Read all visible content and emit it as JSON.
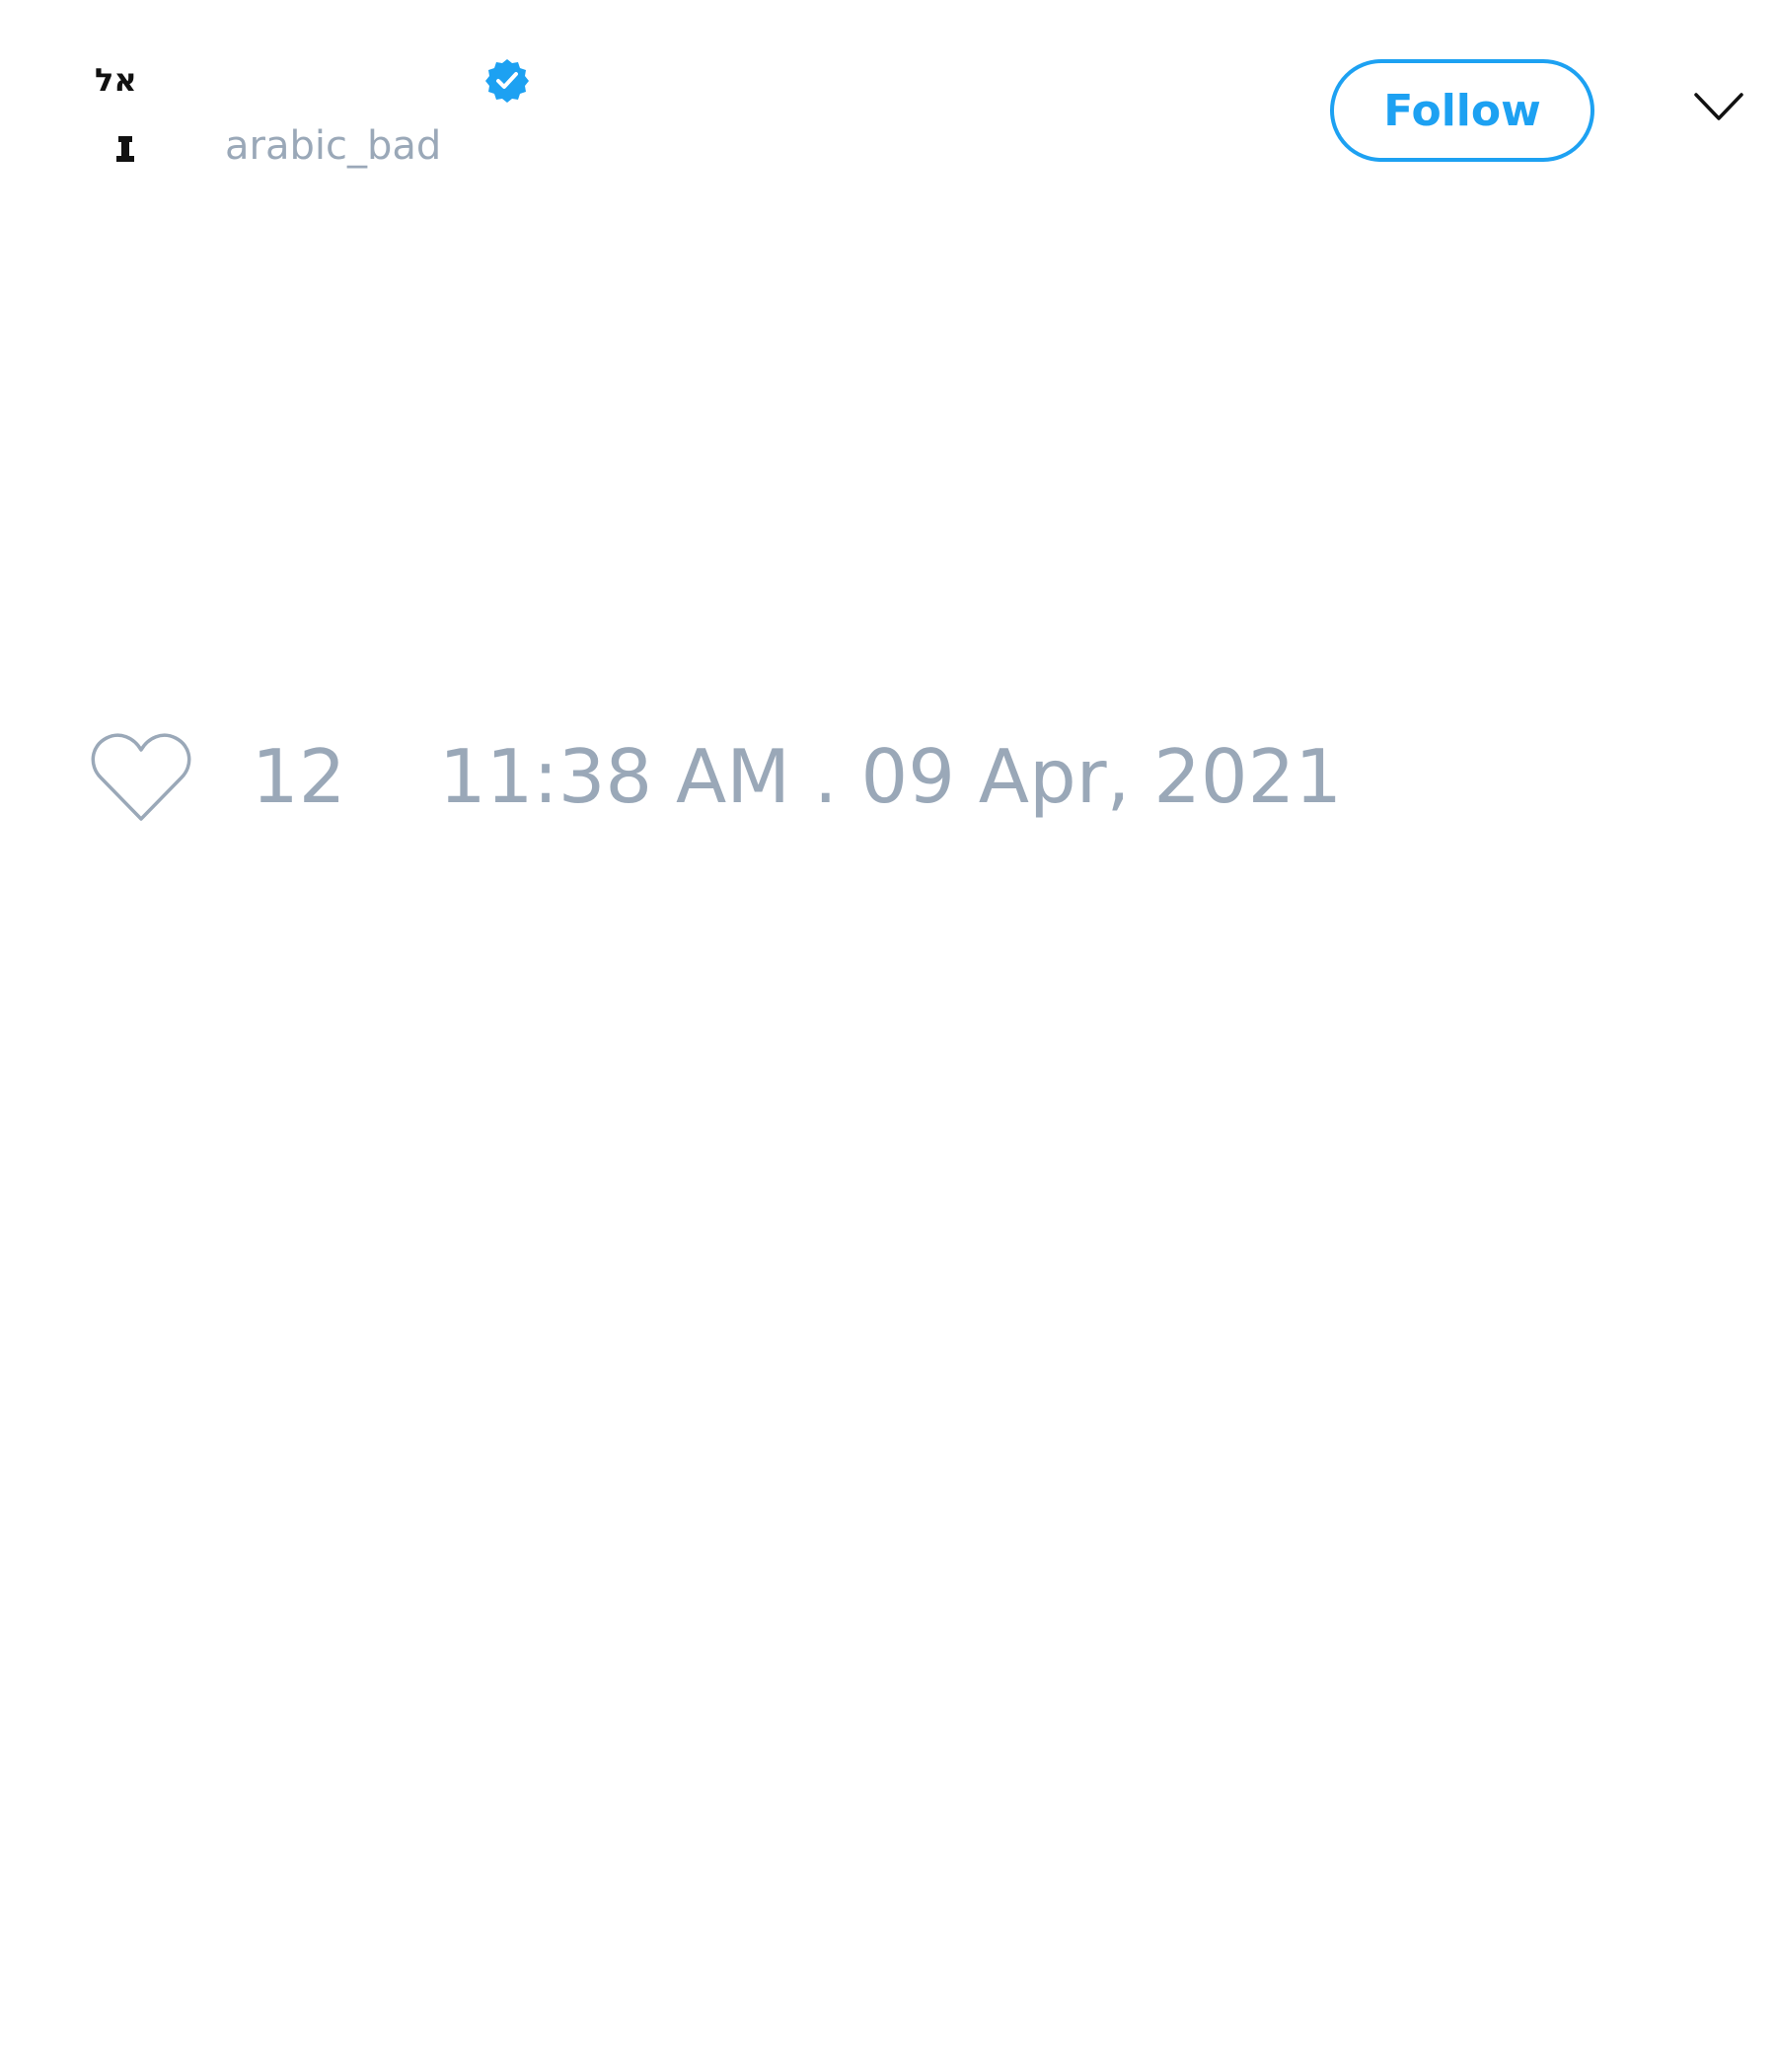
{
  "tweet": {
    "author": {
      "display_name": "",
      "username": "arabic_bad",
      "avatar_icon": "avatar-glyph-icon",
      "verified": true,
      "verified_icon": "verified-badge-icon"
    },
    "follow_label": "Follow",
    "menu_icon": "chevron-down-icon",
    "like_icon": "heart-icon",
    "like_count": "12",
    "timestamp": "11:38 AM . 09 Apr, 2021"
  },
  "colors": {
    "accent": "#1da1f2",
    "muted_text": "#9aa8b8",
    "background": "#ffffff"
  }
}
